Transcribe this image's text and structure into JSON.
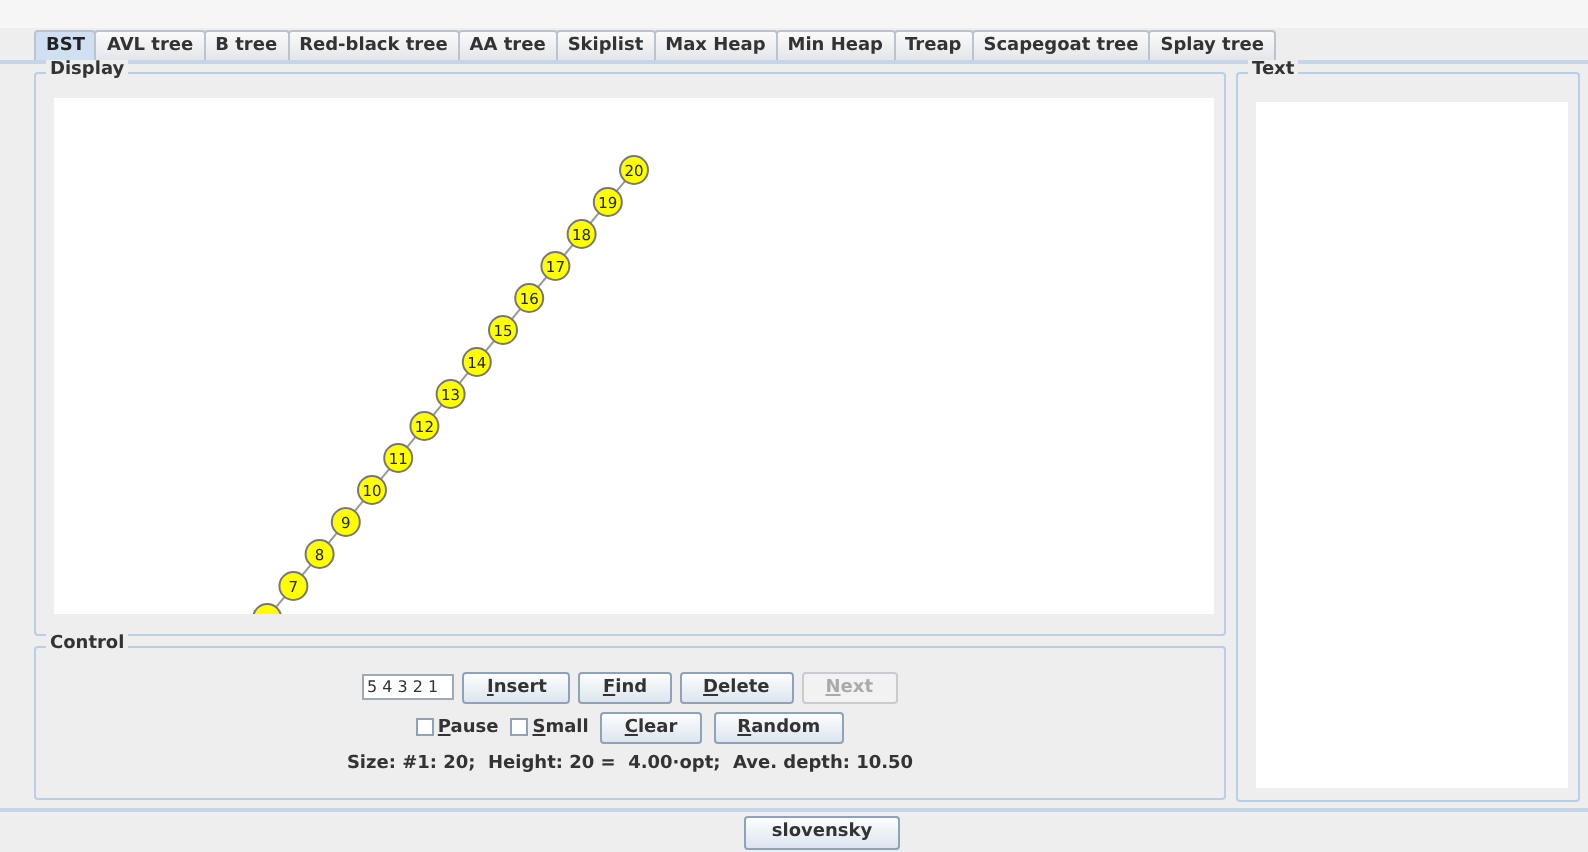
{
  "tabs": [
    {
      "label": "BST",
      "selected": true
    },
    {
      "label": "AVL tree",
      "selected": false
    },
    {
      "label": "B tree",
      "selected": false
    },
    {
      "label": "Red-black tree",
      "selected": false
    },
    {
      "label": "AA tree",
      "selected": false
    },
    {
      "label": "Skiplist",
      "selected": false
    },
    {
      "label": "Max Heap",
      "selected": false
    },
    {
      "label": "Min Heap",
      "selected": false
    },
    {
      "label": "Treap",
      "selected": false
    },
    {
      "label": "Scapegoat tree",
      "selected": false
    },
    {
      "label": "Splay tree",
      "selected": false
    }
  ],
  "display": {
    "title": "Display",
    "nodes": [
      "20",
      "19",
      "18",
      "17",
      "16",
      "15",
      "14",
      "13",
      "12",
      "11",
      "10",
      "9",
      "8",
      "7"
    ],
    "partial_node": true
  },
  "text_panel": {
    "title": "Text"
  },
  "control": {
    "title": "Control",
    "input": {
      "value": "5 4 3 2 1"
    },
    "buttons": [
      {
        "label": "Insert",
        "disabled": false
      },
      {
        "label": "Find",
        "disabled": false
      },
      {
        "label": "Delete",
        "disabled": false
      },
      {
        "label": "Next",
        "disabled": true
      }
    ],
    "checkboxes": [
      {
        "label": "Pause",
        "checked": false
      },
      {
        "label": "Small",
        "checked": false
      }
    ],
    "buttons2": [
      {
        "label": "Clear",
        "disabled": false
      },
      {
        "label": "Random",
        "disabled": false
      }
    ],
    "status": "Size: #1: 20;  Height: 20 =  4.00·opt;  Ave. depth: 10.50"
  },
  "language_button": "slovensky"
}
